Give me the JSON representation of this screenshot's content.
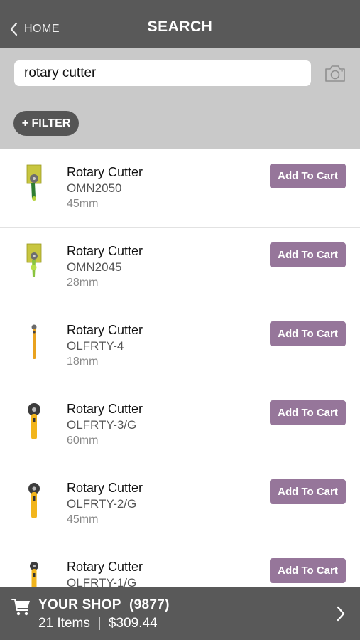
{
  "header": {
    "back_label": "HOME",
    "title": "SEARCH"
  },
  "search": {
    "query": "rotary cutter",
    "filter_label": "+ FILTER"
  },
  "results": [
    {
      "name": "Rotary Cutter",
      "sku": "OMN2050",
      "size": "45mm",
      "button": "Add To Cart",
      "thumb": "green-cutter-package-icon"
    },
    {
      "name": "Rotary Cutter",
      "sku": "OMN2045",
      "size": "28mm",
      "button": "Add To Cart",
      "thumb": "green-cutter-package-icon"
    },
    {
      "name": "Rotary Cutter",
      "sku": "OLFRTY-4",
      "size": "18mm",
      "button": "Add To Cart",
      "thumb": "slim-yellow-cutter-icon"
    },
    {
      "name": "Rotary Cutter",
      "sku": "OLFRTY-3/G",
      "size": "60mm",
      "button": "Add To Cart",
      "thumb": "yellow-cutter-icon"
    },
    {
      "name": "Rotary Cutter",
      "sku": "OLFRTY-2/G",
      "size": "45mm",
      "button": "Add To Cart",
      "thumb": "yellow-cutter-icon"
    },
    {
      "name": "Rotary Cutter",
      "sku": "OLFRTY-1/G",
      "size": "",
      "button": "Add To Cart",
      "thumb": "yellow-cutter-icon"
    }
  ],
  "footer": {
    "shop_label": "YOUR SHOP",
    "shop_number": "(9877)",
    "summary": "21 Items  |  $309.44"
  },
  "colors": {
    "header_bg": "#595959",
    "search_bg": "#c9c9c9",
    "button_accent": "#96769a",
    "filter_bg": "#555555"
  }
}
